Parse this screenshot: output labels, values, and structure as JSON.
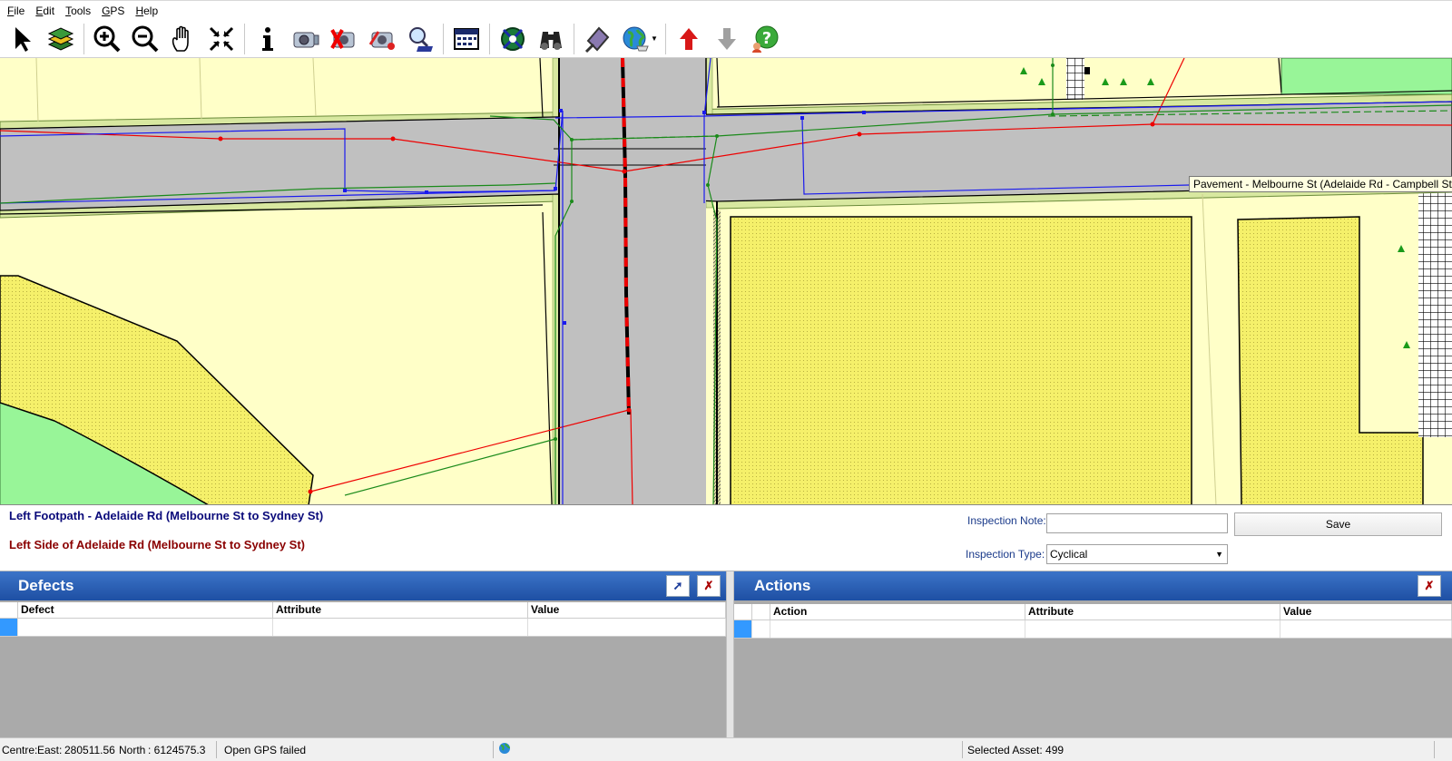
{
  "menu": {
    "items": [
      {
        "u": "F",
        "rest": "ile"
      },
      {
        "u": "E",
        "rest": "dit"
      },
      {
        "u": "T",
        "rest": "ools"
      },
      {
        "u": "G",
        "rest": "PS"
      },
      {
        "u": "H",
        "rest": "elp"
      }
    ]
  },
  "toolbar": {
    "icons": [
      "select-arrow-icon",
      "layers-icon",
      "zoom-in-icon",
      "zoom-out-icon",
      "pan-hand-icon",
      "zoom-extent-icon",
      "info-icon",
      "camera-icon",
      "camera-delete-icon",
      "camera-edit-icon",
      "search-map-icon",
      "calendar-icon",
      "gps-satellite-icon",
      "binoculars-icon",
      "sign-icon",
      "globe-icon",
      "arrow-up-icon",
      "arrow-down-icon",
      "help-icon"
    ]
  },
  "map": {
    "tooltip": "Pavement - Melbourne St (Adelaide Rd - Campbell St)"
  },
  "info": {
    "asset_line_1": "Left Footpath - Adelaide Rd (Melbourne St to Sydney St)",
    "asset_line_2": "Left Side of Adelaide Rd (Melbourne St to Sydney St)",
    "inspection_note_label": "Inspection Note:",
    "inspection_note_value": "",
    "save_label": "Save",
    "inspection_type_label": "Inspection Type:",
    "inspection_type_value": "Cyclical"
  },
  "defects": {
    "title": "Defects",
    "columns": [
      "Defect",
      "Attribute",
      "Value"
    ]
  },
  "actions": {
    "title": "Actions",
    "columns": [
      "Action",
      "Attribute",
      "Value"
    ]
  },
  "status": {
    "centre_label": "Centre:",
    "east_label": "East:",
    "east_value": "280511.56",
    "north_label": "North",
    "north_value": ": 6124575.3",
    "gps_status": "Open GPS failed",
    "selected_asset": "Selected Asset: 499"
  },
  "colors": {
    "panel_header": "#2a5fb5",
    "selection": "#3399ff",
    "road": "#c0c0c0",
    "land": "#ffffc8",
    "property": "#f5f06a",
    "park": "#98f598"
  }
}
